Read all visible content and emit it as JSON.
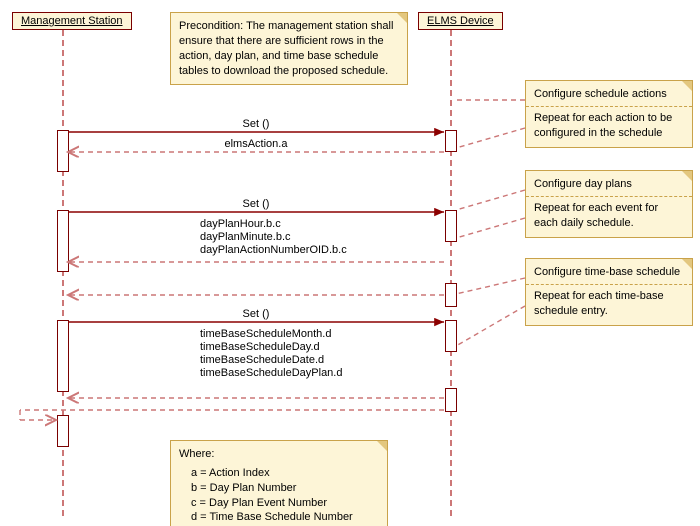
{
  "lifelines": {
    "left": "Management Station",
    "right": "ELMS Device"
  },
  "precondition": "Precondition: The management station shall ensure that there are sufficient rows in the action, day plan, and time base schedule tables to download the proposed schedule.",
  "notes": {
    "n1_title": "Configure schedule actions",
    "n1_body": "Repeat for each action to be configured in the schedule",
    "n2_title": "Configure day plans",
    "n2_body": "Repeat for each event for each daily schedule.",
    "n3_title": "Configure time-base schedule",
    "n3_body": "Repeat for each time-base schedule entry."
  },
  "calls": {
    "set1": "Set ()",
    "set1_return": "elmsAction.a",
    "set2": "Set ()",
    "set2_ret_1": "dayPlanHour.b.c",
    "set2_ret_2": "dayPlanMinute.b.c",
    "set2_ret_3": "dayPlanActionNumberOID.b.c",
    "set3": "Set ()",
    "set3_ret_1": "timeBaseScheduleMonth.d",
    "set3_ret_2": "timeBaseScheduleDay.d",
    "set3_ret_3": "timeBaseScheduleDate.d",
    "set3_ret_4": "timeBaseScheduleDayPlan.d"
  },
  "legend": {
    "title": "Where:",
    "a": "a = Action Index",
    "b": "b = Day Plan Number",
    "c": "c = Day Plan Event Number",
    "d": "d = Time Base Schedule Number"
  }
}
